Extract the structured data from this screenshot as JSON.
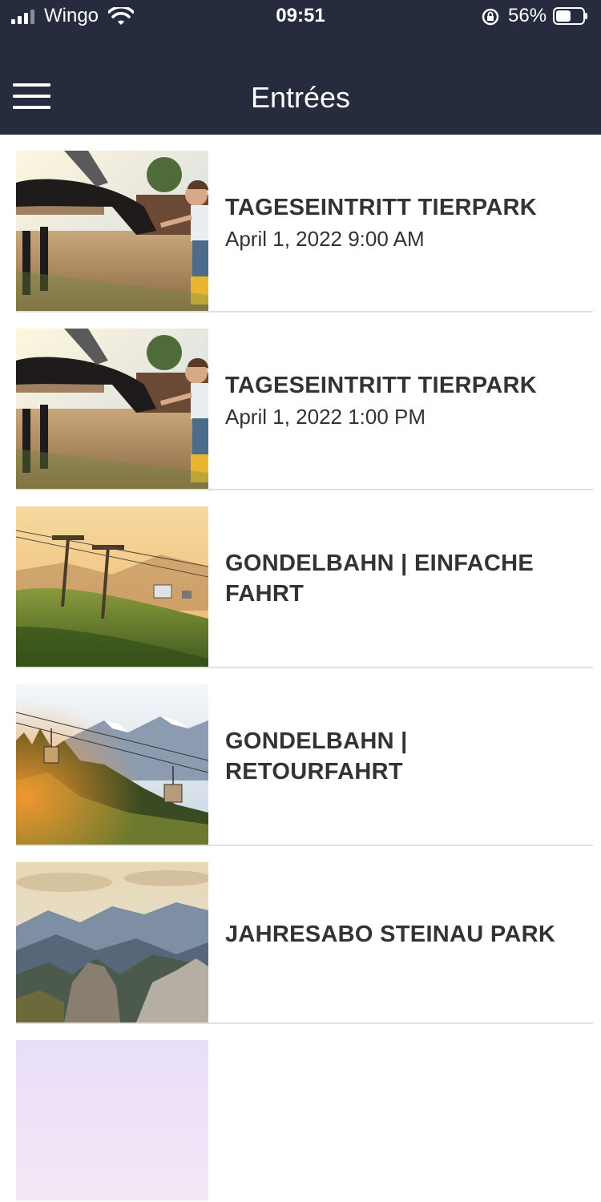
{
  "status_bar": {
    "carrier": "Wingo",
    "time": "09:51",
    "battery": "56%",
    "battery_level": 0.56
  },
  "header": {
    "title": "Entrées",
    "menu_icon": "hamburger-menu-icon"
  },
  "entries": [
    {
      "title": "TAGESEINTRITT TIERPARK",
      "date": "April 1, 2022 9:00 AM",
      "image": "pony-and-child-photo"
    },
    {
      "title": "TAGESEINTRITT TIERPARK",
      "date": "April 1, 2022 1:00 PM",
      "image": "pony-and-child-photo"
    },
    {
      "title": "GONDELBAHN | EINFACHE FAHRT",
      "date": "",
      "image": "gondola-sunset-photo"
    },
    {
      "title": "GONDELBAHN | RETOURFAHRT",
      "date": "",
      "image": "gondola-forest-photo"
    },
    {
      "title": "JAHRESABO STEINAU PARK",
      "date": "",
      "image": "mountain-panorama-photo"
    }
  ]
}
